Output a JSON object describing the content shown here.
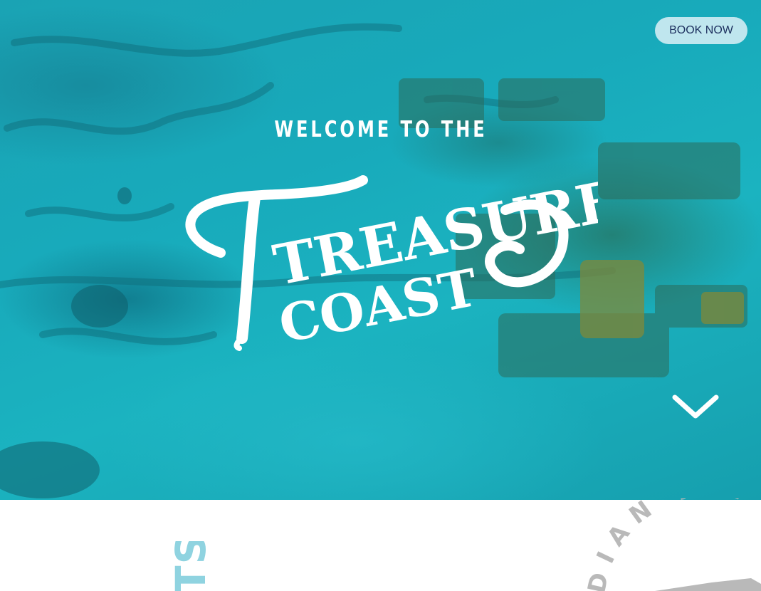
{
  "header": {
    "book_label": "BOOK NOW"
  },
  "hero": {
    "kicker": "WELCOME TO THE",
    "logo_line1": "TREASURE",
    "logo_line2": "COAST",
    "scroll_icon": "chevron-down-icon"
  },
  "below": {
    "left_text": "TS.",
    "badge_text": "DIAN RIV"
  },
  "colors": {
    "button_bg": "#bfe6ee",
    "button_text": "#1c2f5e",
    "water": "#1aa9ba",
    "accent_light": "#8fd3e0",
    "badge_gray": "#b9b9b9"
  }
}
